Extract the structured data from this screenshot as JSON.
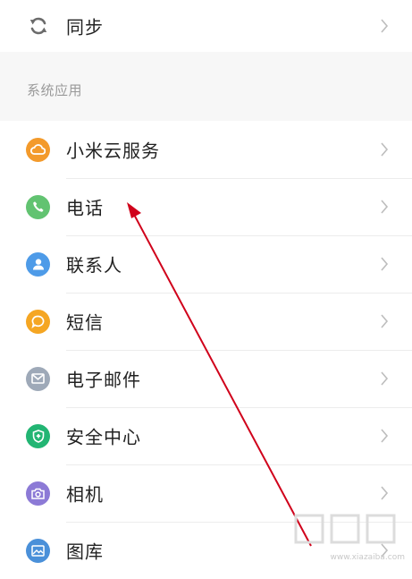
{
  "account_group": {
    "items": [
      {
        "label": "同步",
        "icon": "sync-icon"
      }
    ]
  },
  "section": {
    "title": "系统应用"
  },
  "system_apps": {
    "items": [
      {
        "label": "小米云服务",
        "icon": "cloud-icon",
        "color": "#f39a2b"
      },
      {
        "label": "电话",
        "icon": "phone-icon",
        "color": "#62c371"
      },
      {
        "label": "联系人",
        "icon": "contact-icon",
        "color": "#4e9be8"
      },
      {
        "label": "短信",
        "icon": "message-icon",
        "color": "#f5a623"
      },
      {
        "label": "电子邮件",
        "icon": "mail-icon",
        "color": "#9ea9b8"
      },
      {
        "label": "安全中心",
        "icon": "shield-icon",
        "color": "#22b573"
      },
      {
        "label": "相机",
        "icon": "camera-icon",
        "color": "#8c7ad6"
      },
      {
        "label": "图库",
        "icon": "gallery-icon",
        "color": "#4a90d9"
      }
    ]
  },
  "colors": {
    "arrow": "#d0021b",
    "chevron": "#bdbdbd"
  },
  "watermark": {
    "logo": "下载吧",
    "url": "www.xiazaiba.com"
  }
}
